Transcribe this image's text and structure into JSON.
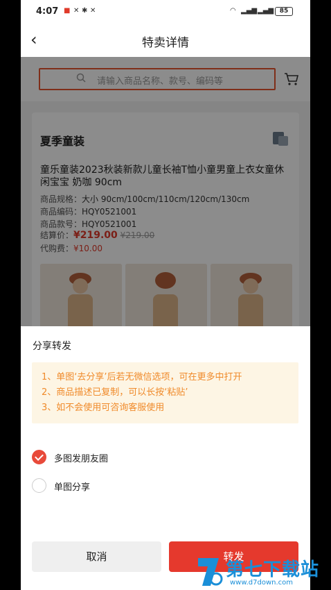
{
  "status_bar": {
    "time": "4:07",
    "battery": "85"
  },
  "nav": {
    "title": "特卖详情"
  },
  "search": {
    "placeholder": "请输入商品名称、款号、编码等"
  },
  "product": {
    "shop_name": "夏季童装",
    "title": "童乐童装2023秋装新款儿童长袖T恤小童男童上衣女童休闲宝宝 奶咖 90cm",
    "spec_label": "商品规格：",
    "spec_value": "大小 90cm/100cm/110cm/120cm/130cm",
    "code_label": "商品编码：",
    "code_value": "HQY0521001",
    "style_label": "商品款号：",
    "style_value": "HQY0521001",
    "price_label": "结算价：",
    "price": "¥219.00",
    "original_price": "¥219.00",
    "fee_label": "代购费：",
    "fee": "¥10.00"
  },
  "share_sheet": {
    "title": "分享转发",
    "tips": [
      "1、单图‘去分享’后若无微信选项，可在更多中打开",
      "2、商品描述已复制，可以长按‘粘贴’",
      "3、如不会使用可咨询客服使用"
    ],
    "options": [
      {
        "label": "多图发朋友圈",
        "selected": true
      },
      {
        "label": "单图分享",
        "selected": false
      }
    ],
    "cancel_label": "取消",
    "forward_label": "转发"
  },
  "watermark": {
    "name": "第七下载站",
    "url": "www.d7down.com"
  },
  "colors": {
    "accent": "#e5392d",
    "tip_text": "#f08a2a",
    "tip_bg": "#fdf5e4",
    "search_border": "#e8542e"
  }
}
